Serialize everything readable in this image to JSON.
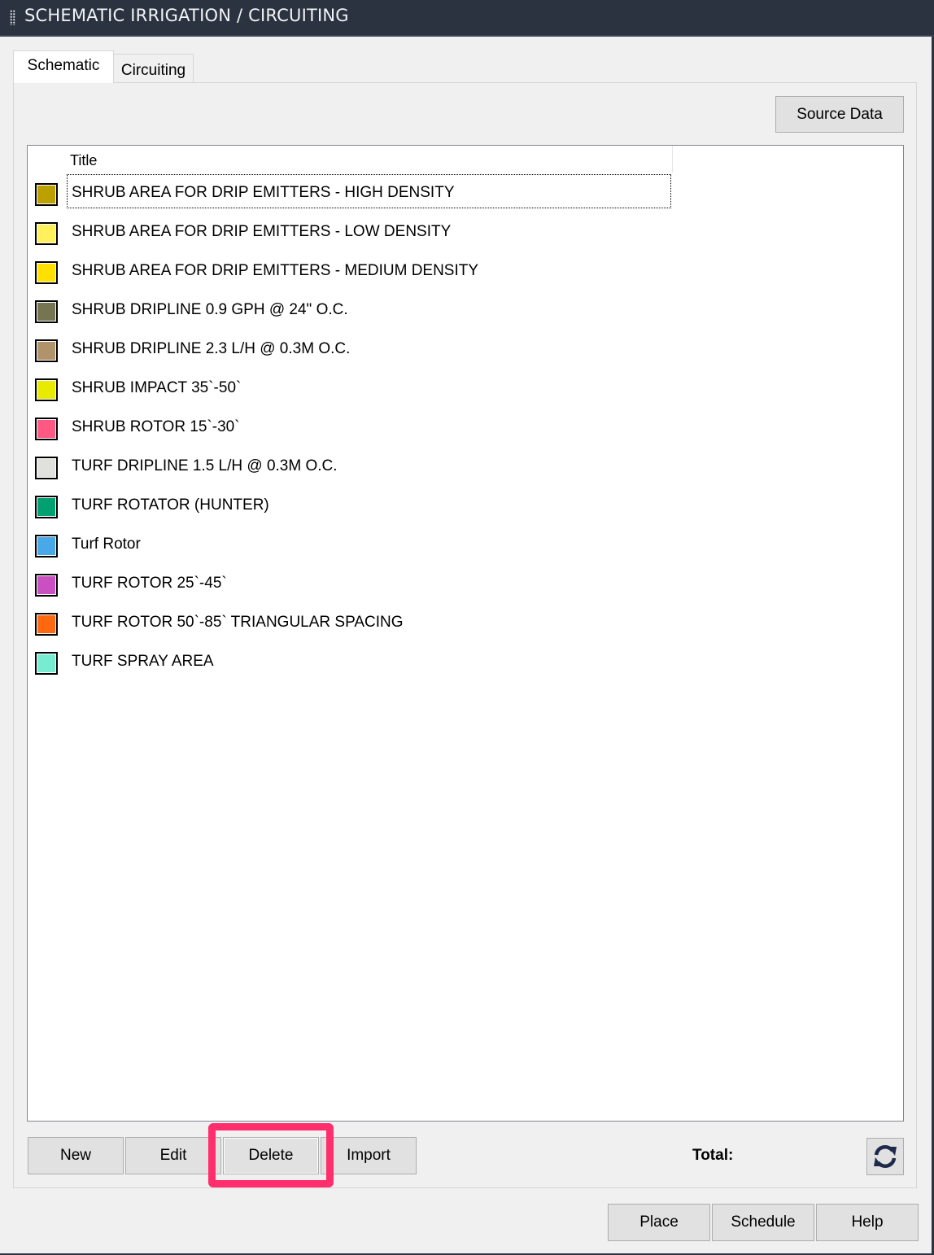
{
  "window": {
    "title": "SCHEMATIC IRRIGATION / CIRCUITING"
  },
  "tabs": [
    {
      "label": "Schematic",
      "active": true
    },
    {
      "label": "Circuiting",
      "active": false
    }
  ],
  "toolbar": {
    "source_data_label": "Source Data"
  },
  "list": {
    "column_header": "Title",
    "selected_index": 0,
    "items": [
      {
        "label": "SHRUB AREA FOR DRIP EMITTERS - HIGH DENSITY",
        "color": "#bca000"
      },
      {
        "label": "SHRUB AREA FOR DRIP EMITTERS - LOW DENSITY",
        "color": "#fff05c"
      },
      {
        "label": "SHRUB AREA FOR DRIP EMITTERS - MEDIUM DENSITY",
        "color": "#ffe000"
      },
      {
        "label": "SHRUB DRIPLINE 0.9 GPH @ 24\" O.C.",
        "color": "#757552"
      },
      {
        "label": "SHRUB DRIPLINE 2.3 L/H @ 0.3M O.C.",
        "color": "#b0936a"
      },
      {
        "label": "SHRUB IMPACT 35`-50`",
        "color": "#e8ea00"
      },
      {
        "label": "SHRUB ROTOR 15`-30`",
        "color": "#ff5883"
      },
      {
        "label": "TURF DRIPLINE 1.5 L/H @ 0.3M O.C.",
        "color": "#e0e0dc"
      },
      {
        "label": "TURF ROTATOR (HUNTER)",
        "color": "#00a070"
      },
      {
        "label": "Turf Rotor",
        "color": "#48a8e8"
      },
      {
        "label": "TURF ROTOR 25`-45`",
        "color": "#c850c0"
      },
      {
        "label": "TURF ROTOR 50`-85` TRIANGULAR SPACING",
        "color": "#ff6810"
      },
      {
        "label": "TURF SPRAY AREA",
        "color": "#78ecd0"
      }
    ]
  },
  "actions": {
    "new_label": "New",
    "edit_label": "Edit",
    "delete_label": "Delete",
    "import_label": "Import",
    "total_label": "Total:",
    "refresh_icon": "refresh-icon"
  },
  "footer": {
    "place_label": "Place",
    "schedule_label": "Schedule",
    "help_label": "Help"
  },
  "annotation": {
    "highlight_color": "#ff2e6c",
    "highlighted_button": "Delete"
  }
}
